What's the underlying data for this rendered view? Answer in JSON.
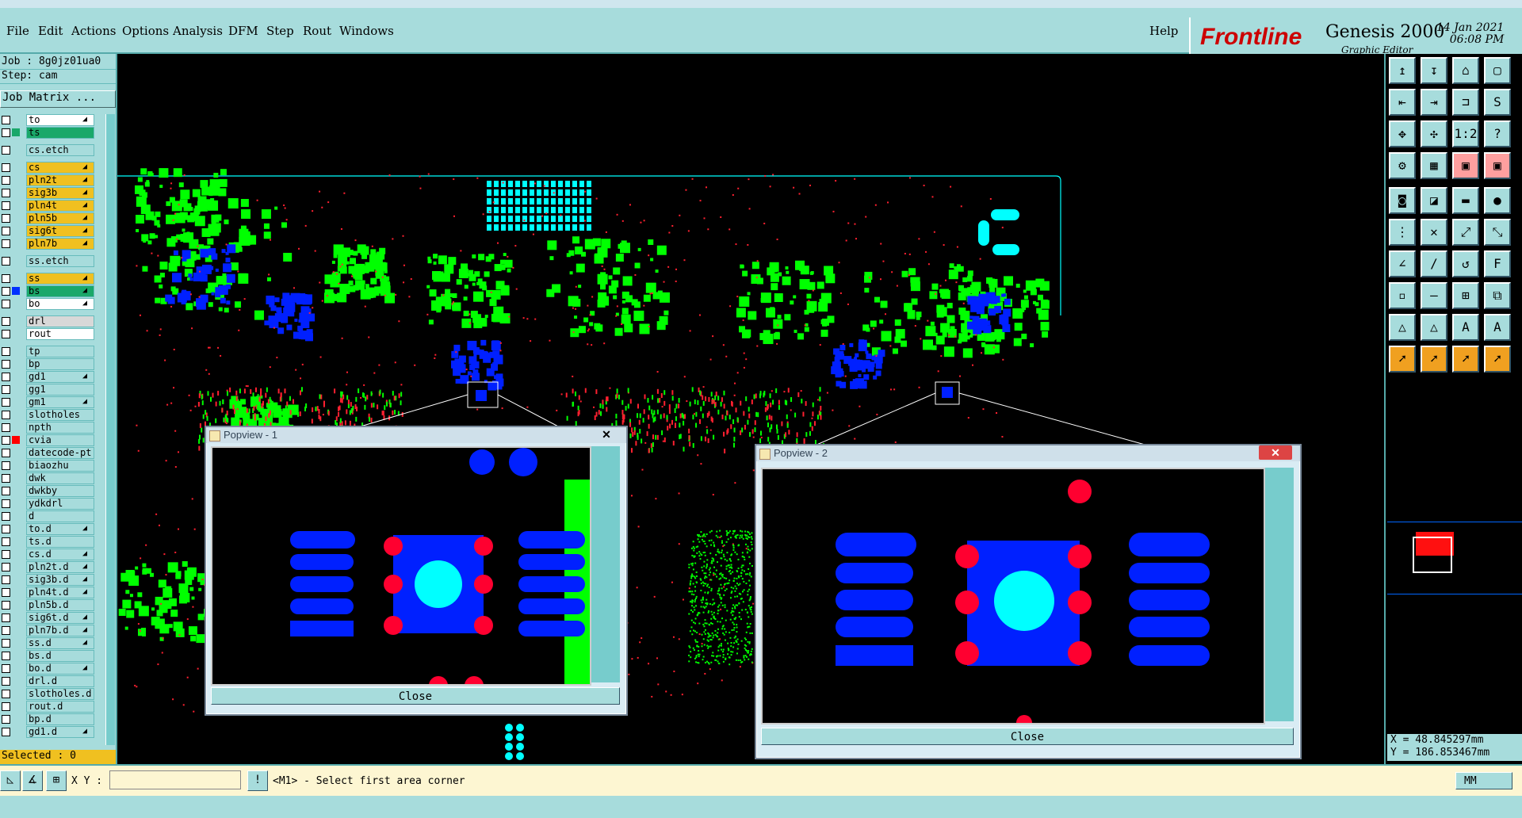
{
  "menu": [
    "File",
    "Edit",
    "Actions",
    "Options",
    "Analysis",
    "DFM",
    "Step",
    "Rout",
    "Windows"
  ],
  "help": "Help",
  "brand": {
    "logo": "Frontline",
    "product": "Genesis 2000",
    "subtitle": "Graphic Editor",
    "date": "14 Jan 2021",
    "time": "06:08 PM"
  },
  "job": {
    "job": "Job : 8g0jz01ua0",
    "step": "Step: cam",
    "matrix_button": "Job Matrix ..."
  },
  "layers": [
    {
      "name": "to",
      "color": "#ffffff",
      "arrow": true
    },
    {
      "name": "ts",
      "color": "#1aa86a",
      "mark": "#1aa86a"
    },
    {
      "name": "cs.etch",
      "color": "#a7dcdc",
      "gap": true
    },
    {
      "name": "cs",
      "color": "#f0c020",
      "arrow": true,
      "gap": true
    },
    {
      "name": "pln2t",
      "color": "#f0c020",
      "arrow": true
    },
    {
      "name": "sig3b",
      "color": "#f0c020",
      "arrow": true
    },
    {
      "name": "pln4t",
      "color": "#f0c020",
      "arrow": true
    },
    {
      "name": "pln5b",
      "color": "#f0c020",
      "arrow": true
    },
    {
      "name": "sig6t",
      "color": "#f0c020",
      "arrow": true
    },
    {
      "name": "pln7b",
      "color": "#f0c020",
      "arrow": true
    },
    {
      "name": "ss.etch",
      "color": "#a7dcdc",
      "gap": true
    },
    {
      "name": "ss",
      "color": "#f0c020",
      "arrow": true,
      "gap": true
    },
    {
      "name": "bs",
      "color": "#1aa86a",
      "mark": "#0030ff",
      "arrow": true
    },
    {
      "name": "bo",
      "color": "#ffffff",
      "arrow": true
    },
    {
      "name": "drl",
      "color": "#d8d8d8",
      "gap": true
    },
    {
      "name": "rout",
      "color": "#ffffff"
    },
    {
      "name": "tp",
      "color": "#a7dcdc",
      "gap": true
    },
    {
      "name": "bp",
      "color": "#a7dcdc"
    },
    {
      "name": "gd1",
      "color": "#a7dcdc",
      "arrow": true
    },
    {
      "name": "gg1",
      "color": "#a7dcdc"
    },
    {
      "name": "gm1",
      "color": "#a7dcdc",
      "arrow": true
    },
    {
      "name": "slotholes",
      "color": "#a7dcdc"
    },
    {
      "name": "npth",
      "color": "#a7dcdc"
    },
    {
      "name": "cvia",
      "color": "#a7dcdc",
      "mark": "#ff0000"
    },
    {
      "name": "datecode-pt",
      "color": "#a7dcdc"
    },
    {
      "name": "biaozhu",
      "color": "#a7dcdc"
    },
    {
      "name": "dwk",
      "color": "#a7dcdc"
    },
    {
      "name": "dwkby",
      "color": "#a7dcdc"
    },
    {
      "name": "ydkdrl",
      "color": "#a7dcdc"
    },
    {
      "name": "d",
      "color": "#a7dcdc"
    },
    {
      "name": "to.d",
      "color": "#a7dcdc",
      "arrow": true
    },
    {
      "name": "ts.d",
      "color": "#a7dcdc"
    },
    {
      "name": "cs.d",
      "color": "#a7dcdc",
      "arrow": true
    },
    {
      "name": "pln2t.d",
      "color": "#a7dcdc",
      "arrow": true
    },
    {
      "name": "sig3b.d",
      "color": "#a7dcdc",
      "arrow": true
    },
    {
      "name": "pln4t.d",
      "color": "#a7dcdc",
      "arrow": true
    },
    {
      "name": "pln5b.d",
      "color": "#a7dcdc"
    },
    {
      "name": "sig6t.d",
      "color": "#a7dcdc",
      "arrow": true
    },
    {
      "name": "pln7b.d",
      "color": "#a7dcdc",
      "arrow": true
    },
    {
      "name": "ss.d",
      "color": "#a7dcdc",
      "arrow": true
    },
    {
      "name": "bs.d",
      "color": "#a7dcdc"
    },
    {
      "name": "bo.d",
      "color": "#a7dcdc",
      "arrow": true
    },
    {
      "name": "drl.d",
      "color": "#a7dcdc"
    },
    {
      "name": "slotholes.d",
      "color": "#a7dcdc"
    },
    {
      "name": "rout.d",
      "color": "#a7dcdc"
    },
    {
      "name": "bp.d",
      "color": "#a7dcdc"
    },
    {
      "name": "gd1.d",
      "color": "#a7dcdc",
      "arrow": true
    }
  ],
  "selected": "Selected : 0",
  "status": {
    "xy_label": "X Y :",
    "message": "<M1> - Select first area corner",
    "units": "MM"
  },
  "cursor": {
    "x": "X = 48.845297mm",
    "y": "Y = 186.853467mm"
  },
  "popview1": {
    "title": "Popview - 1",
    "close": "Close"
  },
  "popview2": {
    "title": "Popview - 2",
    "close": "Close"
  },
  "tools": [
    [
      "↥",
      "↧",
      "⌂",
      "▢"
    ],
    [
      "⇤",
      "⇥",
      "⊐",
      "S"
    ],
    [
      "✥",
      "✣",
      "1:2",
      "?"
    ],
    [
      "⚙",
      "▦",
      "▣",
      "▣"
    ],
    [
      "◙",
      "◪",
      "▬",
      "●"
    ],
    [
      "⋮",
      "✕",
      "⤢",
      "⤡"
    ],
    [
      "∠",
      "∕",
      "↺",
      "F"
    ],
    [
      "▫",
      "—",
      "⊞",
      "⧉"
    ],
    [
      "△",
      "△",
      "A",
      "A"
    ],
    [
      "➚",
      "➚",
      "➚",
      "➚"
    ]
  ],
  "colors": {
    "panel": "#a7dcdc",
    "pad_green": "#00ff00",
    "pad_blue": "#0020ff",
    "pad_red": "#ff0030",
    "pad_cyan": "#00ffff"
  }
}
